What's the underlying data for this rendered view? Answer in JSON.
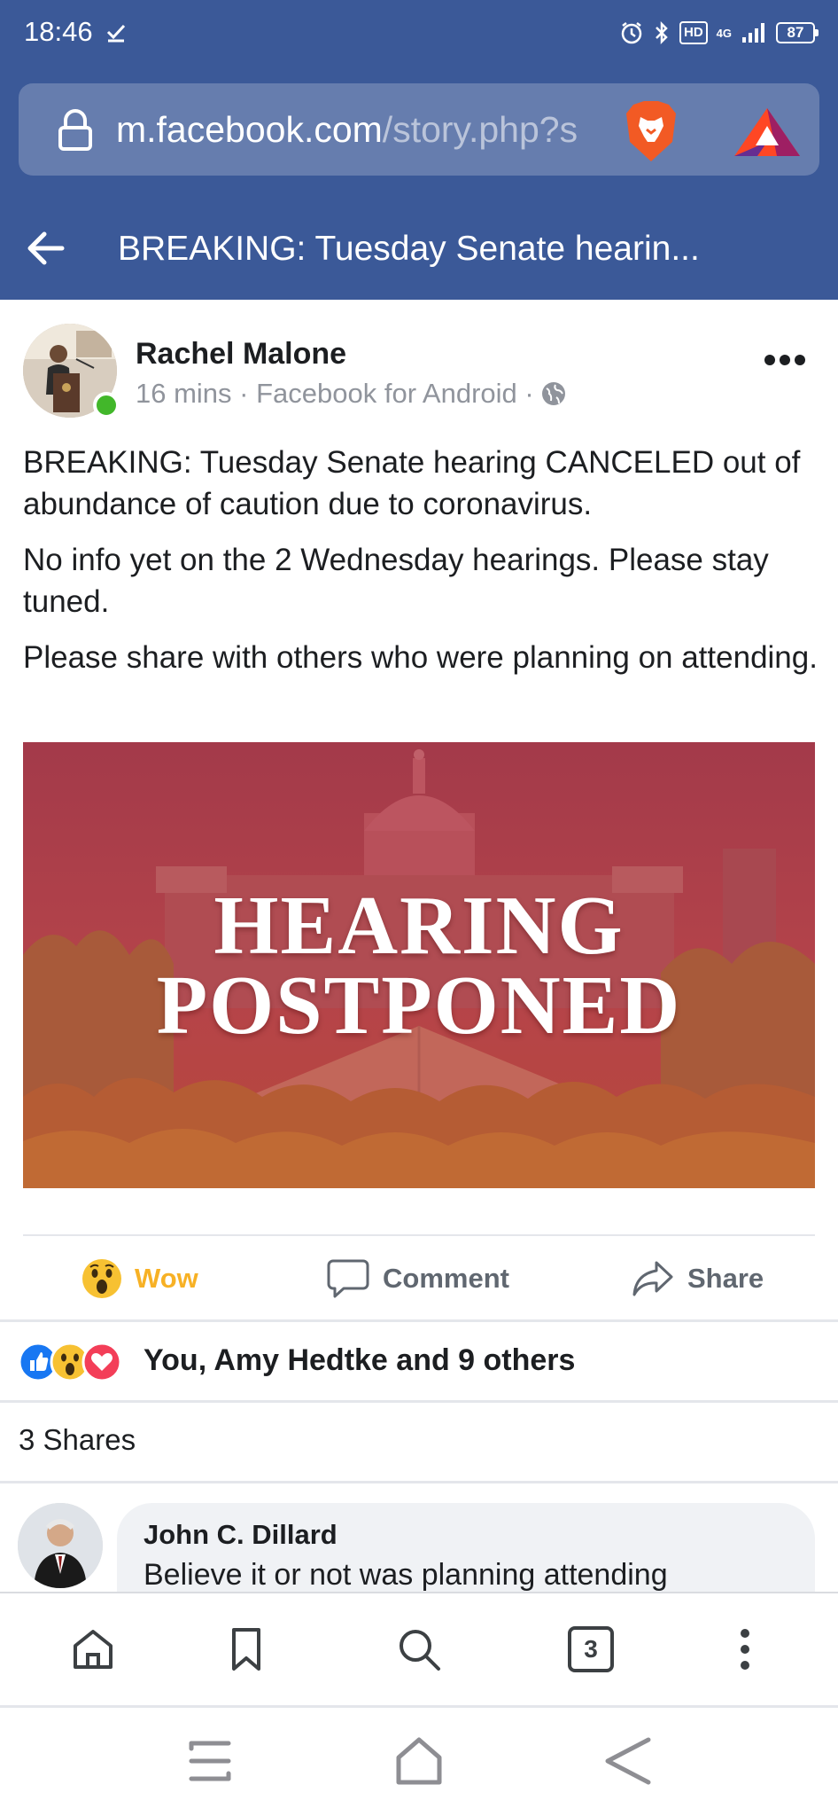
{
  "status_bar": {
    "time": "18:46",
    "network": "4G",
    "hd": "HD",
    "battery": "87"
  },
  "url_bar": {
    "host": "m.facebook.com",
    "path": "/story.php?s"
  },
  "title_bar": {
    "title": "BREAKING: Tuesday Senate hearin..."
  },
  "post": {
    "author": "Rachel Malone",
    "meta": "16 mins · Facebook for Android ·",
    "paragraphs": [
      "BREAKING: Tuesday Senate hearing CANCELED out of abundance of caution due to coronavirus.",
      "No info yet on the 2 Wednesday hearings. Please stay tuned.",
      "Please share with others who were planning on attending."
    ],
    "image_headline_line1": "HEARING",
    "image_headline_line2": "POSTPONED"
  },
  "actions": {
    "wow_label": "Wow",
    "comment_label": "Comment",
    "share_label": "Share"
  },
  "reactions": {
    "summary": "You, Amy Hedtke and 9 others"
  },
  "shares": {
    "label": "3 Shares"
  },
  "comment": {
    "author": "John C. Dillard",
    "text": "Believe it or not was planning attending"
  },
  "browser_bar": {
    "tab_count": "3"
  },
  "colors": {
    "facebook_blue": "#3b5998",
    "wow_yellow": "#f7b125",
    "online_green": "#42b72a",
    "love_red": "#f33e58",
    "like_blue": "#1877f2"
  }
}
